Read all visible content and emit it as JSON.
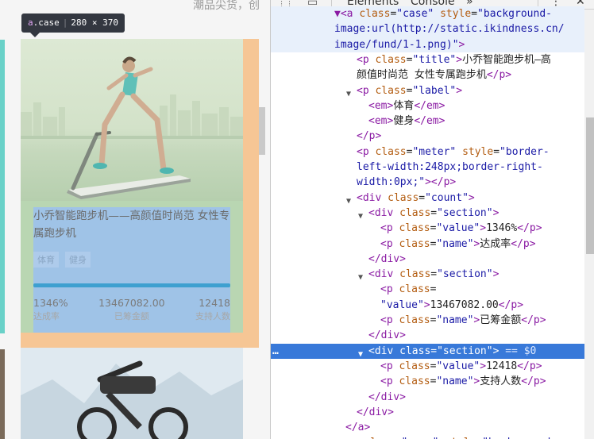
{
  "page": {
    "top_text": "潮品尖货，创",
    "inspect_tooltip": {
      "tag": "a",
      "class": ".case",
      "size": "280 × 370"
    },
    "case": {
      "title": "小乔智能跑步机——高颜值时尚范 女性专属跑步机",
      "labels": [
        "体育",
        "健身"
      ],
      "meter_fill_fraction": 1.0,
      "sections": [
        {
          "value": "1346%",
          "name": "达成率"
        },
        {
          "value": "13467082.00",
          "name": "已筹金额"
        },
        {
          "value": "12418",
          "name": "支持人数"
        }
      ]
    }
  },
  "devtools": {
    "tabs": [
      "Elements",
      "Console"
    ],
    "more_tabs": "»",
    "menu": "⋮",
    "close": "✕",
    "selected_marker": "== $0",
    "lines": [
      [
        [
          "tg",
          "▼<a "
        ],
        [
          "an",
          "class"
        ],
        [
          "tx",
          "="
        ],
        [
          "av",
          "\"case\""
        ],
        [
          "tx",
          " "
        ],
        [
          "an",
          "style"
        ],
        [
          "tx",
          "="
        ],
        [
          "av",
          "\"background-"
        ]
      ],
      [
        [
          "av",
          "image:url(http://static.ikindness.cn/"
        ]
      ],
      [
        [
          "av",
          "image/fund/1-1.png)\""
        ],
        [
          "tg",
          ">"
        ]
      ],
      [
        [
          "tg",
          "<p "
        ],
        [
          "an",
          "class"
        ],
        [
          "tx",
          "="
        ],
        [
          "av",
          "\"title\""
        ],
        [
          "tg",
          ">"
        ],
        [
          "tx",
          "小乔智能跑步机—高"
        ]
      ],
      [
        [
          "tx",
          "颜值时尚范  女性专属跑步机"
        ],
        [
          "tg",
          "</p>"
        ]
      ],
      [
        [
          "tg",
          "<p "
        ],
        [
          "an",
          "class"
        ],
        [
          "tx",
          "="
        ],
        [
          "av",
          "\"label\""
        ],
        [
          "tg",
          ">"
        ]
      ],
      [
        [
          "tg",
          "<em>"
        ],
        [
          "tx",
          "体育"
        ],
        [
          "tg",
          "</em>"
        ]
      ],
      [
        [
          "tg",
          "<em>"
        ],
        [
          "tx",
          "健身"
        ],
        [
          "tg",
          "</em>"
        ]
      ],
      [
        [
          "tg",
          "</p>"
        ]
      ],
      [
        [
          "tg",
          "<p "
        ],
        [
          "an",
          "class"
        ],
        [
          "tx",
          "="
        ],
        [
          "av",
          "\"meter\""
        ],
        [
          "tx",
          " "
        ],
        [
          "an",
          "style"
        ],
        [
          "tx",
          "="
        ],
        [
          "av",
          "\"border-"
        ]
      ],
      [
        [
          "av",
          "left-width:248px;border-right-"
        ]
      ],
      [
        [
          "av",
          "width:0px;\""
        ],
        [
          "tg",
          "></p>"
        ]
      ],
      [
        [
          "tg",
          "<div "
        ],
        [
          "an",
          "class"
        ],
        [
          "tx",
          "="
        ],
        [
          "av",
          "\"count\""
        ],
        [
          "tg",
          ">"
        ]
      ],
      [
        [
          "tg",
          "<div "
        ],
        [
          "an",
          "class"
        ],
        [
          "tx",
          "="
        ],
        [
          "av",
          "\"section\""
        ],
        [
          "tg",
          ">"
        ]
      ],
      [
        [
          "tg",
          "<p "
        ],
        [
          "an",
          "class"
        ],
        [
          "tx",
          "="
        ],
        [
          "av",
          "\"value\""
        ],
        [
          "tg",
          ">"
        ],
        [
          "tx",
          "1346%"
        ],
        [
          "tg",
          "</p>"
        ]
      ],
      [
        [
          "tg",
          "<p "
        ],
        [
          "an",
          "class"
        ],
        [
          "tx",
          "="
        ],
        [
          "av",
          "\"name\""
        ],
        [
          "tg",
          ">"
        ],
        [
          "tx",
          "达成率"
        ],
        [
          "tg",
          "</p>"
        ]
      ],
      [
        [
          "tg",
          "</div>"
        ]
      ],
      [
        [
          "tg",
          "<div "
        ],
        [
          "an",
          "class"
        ],
        [
          "tx",
          "="
        ],
        [
          "av",
          "\"section\""
        ],
        [
          "tg",
          ">"
        ]
      ],
      [
        [
          "tg",
          "<p "
        ],
        [
          "an",
          "class"
        ],
        [
          "tx",
          "="
        ]
      ],
      [
        [
          "av",
          "\"value\""
        ],
        [
          "tg",
          ">"
        ],
        [
          "tx",
          "13467082.00"
        ],
        [
          "tg",
          "</p>"
        ]
      ],
      [
        [
          "tg",
          "<p "
        ],
        [
          "an",
          "class"
        ],
        [
          "tx",
          "="
        ],
        [
          "av",
          "\"name\""
        ],
        [
          "tg",
          ">"
        ],
        [
          "tx",
          "已筹金额"
        ],
        [
          "tg",
          "</p>"
        ]
      ],
      [
        [
          "tg",
          "</div>"
        ]
      ],
      [
        [
          "tg",
          "<div "
        ],
        [
          "an",
          "class"
        ],
        [
          "tx",
          "="
        ],
        [
          "av",
          "\"section\""
        ],
        [
          "tg",
          ">"
        ],
        [
          "eq0",
          " == $0"
        ]
      ],
      [
        [
          "tg",
          "<p "
        ],
        [
          "an",
          "class"
        ],
        [
          "tx",
          "="
        ],
        [
          "av",
          "\"value\""
        ],
        [
          "tg",
          ">"
        ],
        [
          "tx",
          "12418"
        ],
        [
          "tg",
          "</p>"
        ]
      ],
      [
        [
          "tg",
          "<p "
        ],
        [
          "an",
          "class"
        ],
        [
          "tx",
          "="
        ],
        [
          "av",
          "\"name\""
        ],
        [
          "tg",
          ">"
        ],
        [
          "tx",
          "支持人数"
        ],
        [
          "tg",
          "</p>"
        ]
      ],
      [
        [
          "tg",
          "</div>"
        ]
      ],
      [
        [
          "tg",
          "</div>"
        ]
      ],
      [
        [
          "tg",
          "</a>"
        ]
      ],
      [
        [
          "tg",
          "<a "
        ],
        [
          "an",
          "class"
        ],
        [
          "tx",
          "="
        ],
        [
          "av",
          "\"case\""
        ],
        [
          "tx",
          " "
        ],
        [
          "an",
          "style"
        ],
        [
          "tx",
          "="
        ],
        [
          "av",
          "\"background-"
        ]
      ]
    ]
  }
}
